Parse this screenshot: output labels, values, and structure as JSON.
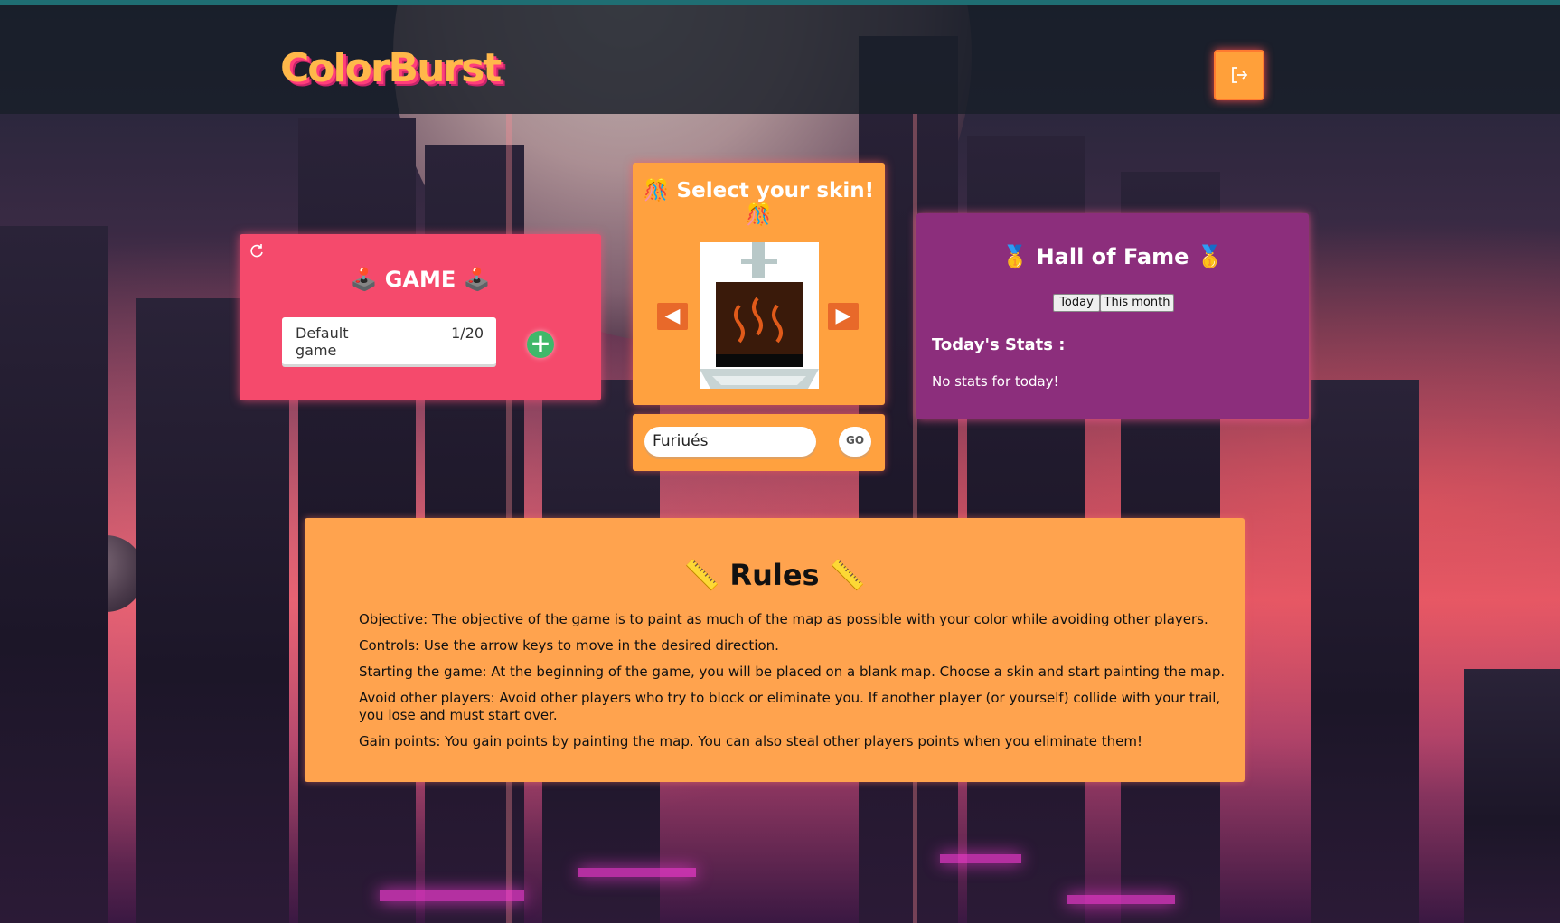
{
  "header": {
    "logo_text": "ColorBurst",
    "logout_icon": "logout-icon"
  },
  "game_panel": {
    "refresh_icon": "refresh-icon",
    "title": "🕹️ GAME 🕹️",
    "games": [
      {
        "name": "Default game",
        "players": "1/20"
      }
    ],
    "add_label": "+"
  },
  "skin_panel": {
    "title": "🎊 Select your skin! 🎊",
    "prev_label": "◀",
    "next_label": "▶",
    "skin_icon": "toaster-skin-icon"
  },
  "name_panel": {
    "name_value": "Furiués",
    "go_label": "GO"
  },
  "hall_of_fame": {
    "title": "🥇 Hall of Fame 🥇",
    "tabs": [
      "Today",
      "This month"
    ],
    "stats_title": "Today's Stats :",
    "empty_text": "No stats for today!"
  },
  "rules": {
    "title": "📏 Rules 📏",
    "items": [
      "Objective: The objective of the game is to paint as much of the map as possible with your color while avoiding other players.",
      "Controls: Use the arrow keys to move in the desired direction.",
      "Starting the game: At the beginning of the game, you will be placed on a blank map. Choose a skin and start painting the map.",
      "Avoid other players: Avoid other players who try to block or eliminate you. If another player (or yourself) collide with your trail, you lose and must start over.",
      "Gain points: You gain points by painting the map. You can also steal other players points when you eliminate them!"
    ]
  },
  "colors": {
    "game_card": "#f54a6c",
    "skin_card": "#ffa13f",
    "hall_card": "#8c2e7c",
    "rules_card": "#ffa34e",
    "accent": "#ffa03a"
  }
}
